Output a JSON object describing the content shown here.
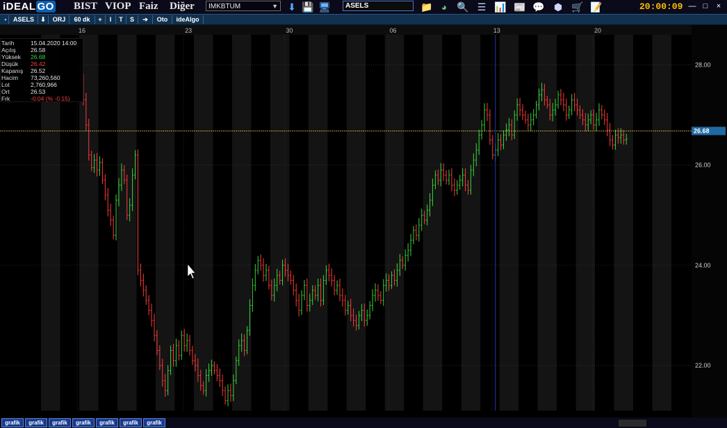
{
  "app": {
    "logo_text": "iDEAL",
    "logo_accent": "GO",
    "clock": "20:00:09"
  },
  "menu": [
    {
      "label": "BIST"
    },
    {
      "label": "VIOP"
    },
    {
      "label": "Faiz"
    },
    {
      "label": "Diğer"
    }
  ],
  "market_select": {
    "value": "IMKBTUM"
  },
  "symbol_search": {
    "value": "ASELS"
  },
  "toolbar_icons": [
    "download-icon",
    "save-icon",
    "monitor-icon",
    "folder-icon",
    "pie-chart-icon",
    "magnifier-icon",
    "bars-icon",
    "price-chart-icon",
    "news-icon",
    "chat-icon",
    "package-icon",
    "cart-icon",
    "notes-icon"
  ],
  "window_buttons": [
    "—",
    "□",
    "×"
  ],
  "toolbar": {
    "symbol": "ASELS",
    "buttons": [
      "ORJ",
      "60 dk",
      "+",
      "I",
      "T",
      "S",
      "Oto",
      "ideAlgo"
    ]
  },
  "info": {
    "rows": [
      {
        "label": "Tarih",
        "value": "15.04.2020 14:00",
        "color": "#e6e6e6"
      },
      {
        "label": "Açılış",
        "value": "26.58",
        "color": "#e6e6e6"
      },
      {
        "label": "Yüksek",
        "value": "26.68",
        "color": "#39d639"
      },
      {
        "label": "Düşük",
        "value": "26.42",
        "color": "#ff3b3b"
      },
      {
        "label": "Kapanış",
        "value": "26.52",
        "color": "#e6e6e6"
      },
      {
        "label": "Hacim",
        "value": "73,260,560",
        "color": "#e6e6e6"
      },
      {
        "label": "Lot",
        "value": "2,760,966",
        "color": "#e6e6e6"
      },
      {
        "label": "Ort",
        "value": "26.53",
        "color": "#e6e6e6"
      },
      {
        "label": "Frk",
        "value": "-0.04 (% -0.15)",
        "color": "#ff3b3b"
      }
    ]
  },
  "bottom_tabs": [
    "grafik",
    "grafik",
    "grafik",
    "grafik",
    "grafik",
    "grafik",
    "grafik"
  ],
  "chart_data": {
    "type": "bar",
    "x_ticks": [
      {
        "label": "16",
        "bar": 0
      },
      {
        "label": "23",
        "bar": 39
      },
      {
        "label": "30",
        "bar": 76
      },
      {
        "label": "06",
        "bar": 114
      },
      {
        "label": "13",
        "bar": 152
      },
      {
        "label": "20",
        "bar": 189
      }
    ],
    "y_ticks": [
      "22.00",
      "24.00",
      "26.00",
      "28.00"
    ],
    "ylim": [
      21.1,
      28.6
    ],
    "current_price": 26.68,
    "current_price_label": "26.68",
    "colors": {
      "up": "#39d639",
      "down": "#ff3b3b",
      "current_line": "#e8d24a",
      "day_band": "#141414",
      "grid": "#3a3a3a",
      "label_bg": "#1f6aa3"
    },
    "closes": [
      27.7,
      27.3,
      26.8,
      26.2,
      25.95,
      26.1,
      25.9,
      26.05,
      25.7,
      25.4,
      25.1,
      24.9,
      24.6,
      25.3,
      25.6,
      25.9,
      25.7,
      25.0,
      25.2,
      25.8,
      26.2,
      23.9,
      23.7,
      23.5,
      23.3,
      23.1,
      22.9,
      22.6,
      22.3,
      22.0,
      21.7,
      21.5,
      21.9,
      22.3,
      22.1,
      22.4,
      22.2,
      22.6,
      22.4,
      22.5,
      22.3,
      22.1,
      22.0,
      21.8,
      21.6,
      21.5,
      21.8,
      21.9,
      22.0,
      21.9,
      21.8,
      21.7,
      21.5,
      21.3,
      21.5,
      21.4,
      21.7,
      22.1,
      22.4,
      22.5,
      22.3,
      22.7,
      23.2,
      23.6,
      23.9,
      24.1,
      24.0,
      23.8,
      23.9,
      23.6,
      23.4,
      23.6,
      23.8,
      23.7,
      24.0,
      23.9,
      23.8,
      23.7,
      23.5,
      23.3,
      23.1,
      23.4,
      23.6,
      23.2,
      23.3,
      23.5,
      23.4,
      23.6,
      23.3,
      23.7,
      23.9,
      23.8,
      23.7,
      23.5,
      23.6,
      23.4,
      23.3,
      23.1,
      23.2,
      23.0,
      22.9,
      22.8,
      23.0,
      23.1,
      22.9,
      23.0,
      23.2,
      23.4,
      23.5,
      23.4,
      23.3,
      23.6,
      23.7,
      23.6,
      23.8,
      23.7,
      23.9,
      24.1,
      24.0,
      24.2,
      24.3,
      24.5,
      24.7,
      24.6,
      24.8,
      25.0,
      24.9,
      25.1,
      25.3,
      25.6,
      25.8,
      25.7,
      25.9,
      25.8,
      25.7,
      25.8,
      25.6,
      25.5,
      25.6,
      25.7,
      25.8,
      25.6,
      25.5,
      25.9,
      26.1,
      26.3,
      26.6,
      26.8,
      27.1,
      27.0,
      26.5,
      26.2,
      26.3,
      26.5,
      26.4,
      26.6,
      26.7,
      26.8,
      26.6,
      27.0,
      27.2,
      27.1,
      27.0,
      26.9,
      26.8,
      26.9,
      27.0,
      27.2,
      27.4,
      27.5,
      27.3,
      27.2,
      27.0,
      27.1,
      27.2,
      27.4,
      27.3,
      27.2,
      27.0,
      27.1,
      27.3,
      27.2,
      27.1,
      27.0,
      26.9,
      26.8,
      26.9,
      27.0,
      26.8,
      26.9,
      27.1,
      27.0,
      26.9,
      26.7,
      26.5,
      26.4,
      26.6,
      26.55,
      26.6,
      26.5,
      26.52
    ]
  }
}
